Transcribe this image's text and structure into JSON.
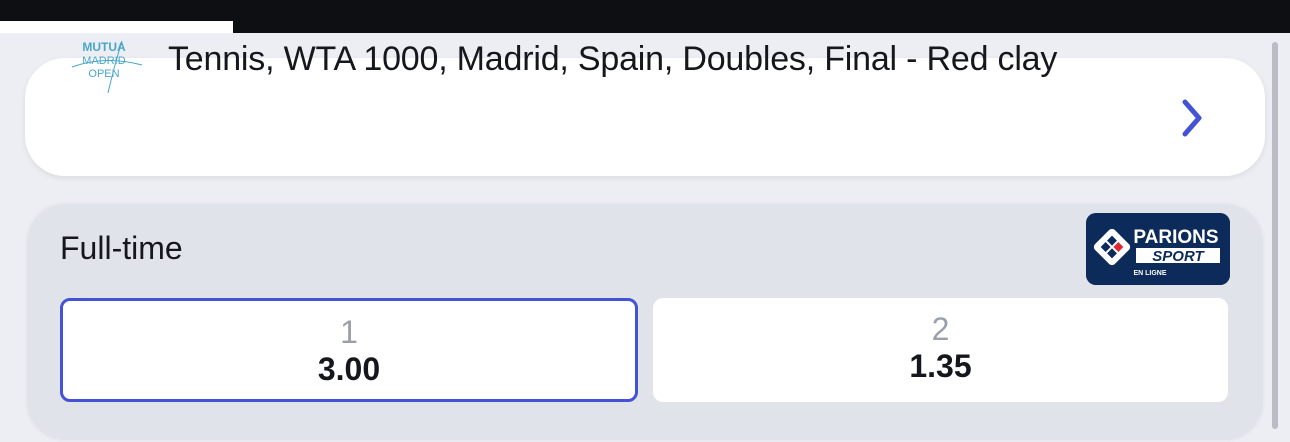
{
  "tournament": {
    "title": "Tennis, WTA 1000, Madrid, Spain, Doubles, Final - Red clay",
    "logo_text": [
      "MUTUA",
      "MADRID",
      "OPEN"
    ]
  },
  "market": {
    "title": "Full-time",
    "brand_text": [
      "PARIONS",
      "SPORT",
      "EN LIGNE"
    ],
    "selections": [
      {
        "label": "1",
        "odds": "3.00",
        "selected": true
      },
      {
        "label": "2",
        "odds": "1.35",
        "selected": false
      }
    ]
  },
  "colors": {
    "accent": "#4453d6",
    "brand_bg": "#0c2b5a",
    "logo": "#4aa6c9"
  },
  "icons": [
    "chevron-right-icon",
    "mutua-madrid-open-logo",
    "parions-sport-logo"
  ]
}
